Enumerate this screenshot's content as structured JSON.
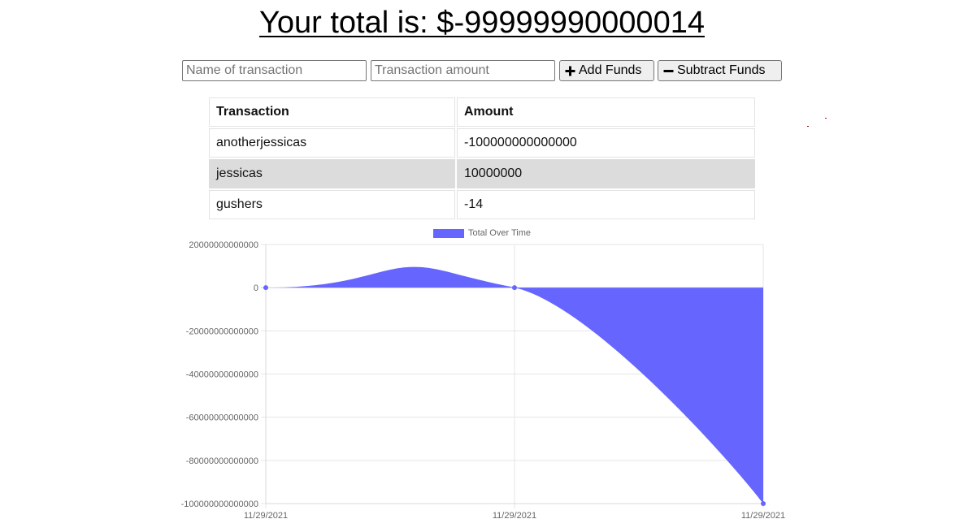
{
  "header": {
    "total_prefix": "Your total is: $",
    "total_value": "-99999990000014"
  },
  "form": {
    "name_placeholder": "Name of transaction",
    "amount_placeholder": "Transaction amount",
    "add_label": "Add Funds",
    "subtract_label": "Subtract Funds",
    "add_icon": "plus-icon",
    "subtract_icon": "minus-icon"
  },
  "table": {
    "headers": [
      "Transaction",
      "Amount"
    ],
    "rows": [
      {
        "name": "anotherjessicas",
        "amount": "-100000000000000"
      },
      {
        "name": "jessicas",
        "amount": "10000000"
      },
      {
        "name": "gushers",
        "amount": "-14"
      }
    ]
  },
  "chart_data": {
    "type": "area",
    "title": "",
    "xlabel": "",
    "ylabel": "",
    "legend": "top-center",
    "grid": true,
    "color": "#6666ff",
    "x": [
      "11/29/2021",
      "11/29/2021",
      "11/29/2021"
    ],
    "series": [
      {
        "name": "Total Over Time",
        "values": [
          -14,
          9999986,
          -99999990000014
        ]
      }
    ],
    "ylim": [
      -100000000000000,
      20000000000000
    ],
    "yticks": [
      "20000000000000",
      "0",
      "-20000000000000",
      "-40000000000000",
      "-60000000000000",
      "-80000000000000",
      "-100000000000000"
    ]
  }
}
